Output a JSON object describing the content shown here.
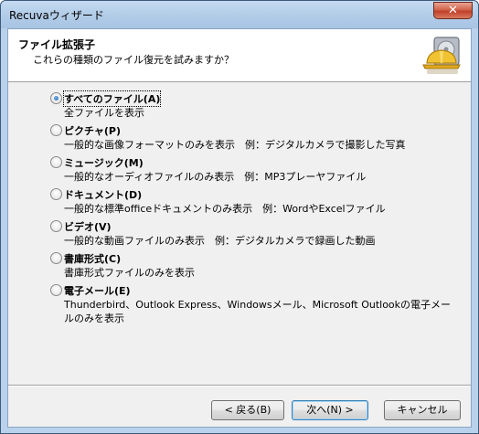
{
  "window": {
    "title": "Recuvaウィザード",
    "close_glyph": "✕"
  },
  "header": {
    "title": "ファイル拡張子",
    "subtitle": "これらの種類のファイル復元を試みますか？",
    "logo_icon": "recuva-hardhat-drive-icon"
  },
  "options": [
    {
      "label": "すべてのファイル(A)",
      "desc": "全ファイルを表示",
      "checked": true
    },
    {
      "label": "ピクチャ(P)",
      "desc": "一般的な画像フォーマットのみを表示　例：デジタルカメラで撮影した写真",
      "checked": false
    },
    {
      "label": "ミュージック(M)",
      "desc": "一般的なオーディオファイルのみ表示　例：MP3プレーヤファイル",
      "checked": false
    },
    {
      "label": "ドキュメント(D)",
      "desc": "一般的な標準officeドキュメントのみ表示　例：WordやExcelファイル",
      "checked": false
    },
    {
      "label": "ビデオ(V)",
      "desc": "一般的な動画ファイルのみ表示　例：デジタルカメラで録画した動画",
      "checked": false
    },
    {
      "label": "書庫形式(C)",
      "desc": "書庫形式ファイルのみを表示",
      "checked": false
    },
    {
      "label": "電子メール(E)",
      "desc": "Thunderbird、Outlook Express、Windowsメール、Microsoft Outlookの電子メールのみを表示",
      "checked": false
    }
  ],
  "buttons": {
    "back": "< 戻る(B)",
    "next": "次へ(N) >",
    "cancel": "キャンセル"
  },
  "colors": {
    "accent": "#1c5fa8",
    "frame": "#b9d1ea",
    "close": "#c0402a"
  }
}
